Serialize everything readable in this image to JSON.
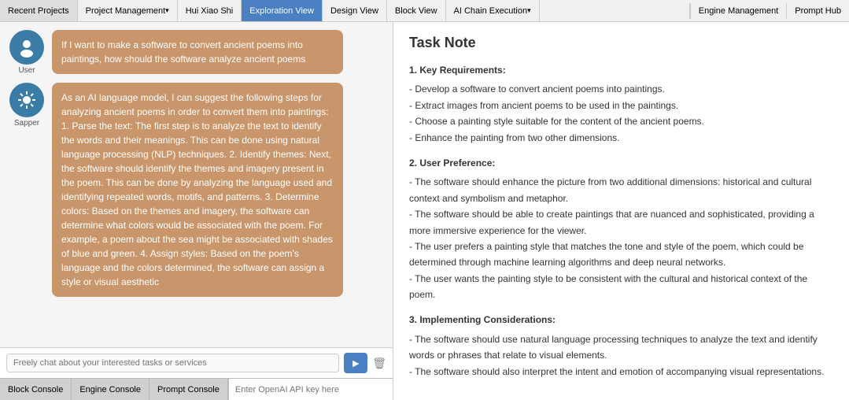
{
  "nav": {
    "tabs": [
      {
        "label": "Recent Projects",
        "active": false,
        "dropdown": false
      },
      {
        "label": "Project Management",
        "active": false,
        "dropdown": true
      },
      {
        "label": "Hui Xiao Shi",
        "active": false,
        "dropdown": false
      },
      {
        "label": "Exploration View",
        "active": true,
        "dropdown": false
      },
      {
        "label": "Design View",
        "active": false,
        "dropdown": false
      },
      {
        "label": "Block View",
        "active": false,
        "dropdown": false
      },
      {
        "label": "AI Chain Execution",
        "active": false,
        "dropdown": true
      }
    ],
    "right_tabs": [
      {
        "label": "Engine Management"
      },
      {
        "label": "Prompt Hub"
      }
    ]
  },
  "chat": {
    "messages": [
      {
        "role": "user",
        "avatar_label": "User",
        "bubble_text": "If I want to make a software to convert ancient poems into paintings, how should the software analyze ancient poems"
      },
      {
        "role": "assistant",
        "avatar_label": "Sapper",
        "bubble_text": "As an AI language model, I can suggest the following steps for analyzing ancient poems in order to convert them into paintings: 1. Parse the text: The first step is to analyze the text to identify the words and their meanings. This can be done using natural language processing (NLP) techniques. 2. Identify themes: Next, the software should identify the themes and imagery present in the poem. This can be done by analyzing the language used and identifying repeated words, motifs, and patterns. 3. Determine colors: Based on the themes and imagery, the software can determine what colors would be associated with the poem. For example, a poem about the sea might be associated with shades of blue and green. 4. Assign styles: Based on the poem's language and the colors determined, the software can assign a style or visual aesthetic"
      }
    ],
    "input_placeholder": "Freely chat about your interested tasks or services",
    "send_icon": "▶",
    "delete_icon": "🗑"
  },
  "bottom_bar": {
    "tabs": [
      {
        "label": "Block Console"
      },
      {
        "label": "Engine Console"
      },
      {
        "label": "Prompt Console"
      }
    ],
    "input_placeholder": "Enter OpenAI API key here"
  },
  "task_note": {
    "title": "Task Note",
    "sections": [
      {
        "heading": "1. Key Requirements:",
        "items": [
          "- Develop a software to convert ancient poems into paintings.",
          "- Extract images from ancient poems to be used in the paintings.",
          "- Choose a painting style suitable for the content of the ancient poems.",
          "- Enhance the painting from two other dimensions."
        ]
      },
      {
        "heading": "2. User Preference:",
        "items": [
          "- The software should enhance the picture from two additional dimensions: historical and cultural context and symbolism and metaphor.",
          "- The software should be able to create paintings that are nuanced and sophisticated, providing a more immersive experience for the viewer.",
          "- The user prefers a painting style that matches the tone and style of the poem, which could be determined through machine learning algorithms and deep neural networks.",
          "- The user wants the painting style to be consistent with the cultural and historical context of the poem."
        ]
      },
      {
        "heading": "3. Implementing Considerations:",
        "items": [
          "- The software should use natural language processing techniques to analyze the text and identify words or phrases that relate to visual elements.",
          "- The software should also interpret the intent and emotion of accompanying visual representations."
        ]
      }
    ]
  }
}
